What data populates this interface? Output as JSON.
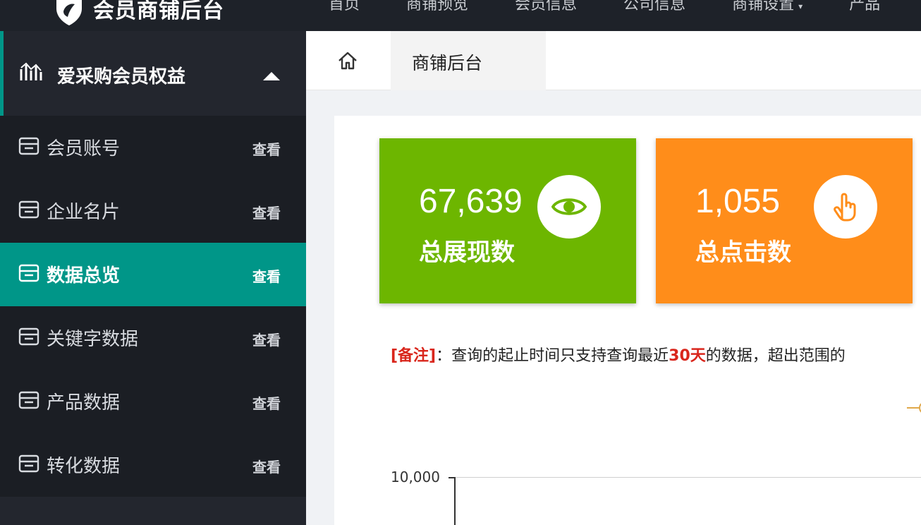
{
  "header": {
    "title": "会员商铺后台",
    "nav": [
      {
        "label": "首页"
      },
      {
        "label": "商铺预览"
      },
      {
        "label": "会员信息"
      },
      {
        "label": "公司信息"
      },
      {
        "label": "商铺设置"
      },
      {
        "label": "产品"
      }
    ]
  },
  "sidebar": {
    "group": {
      "label": "爱采购会员权益",
      "icon": "chart-bars-icon"
    },
    "items": [
      {
        "label": "会员账号",
        "action": "查看"
      },
      {
        "label": "企业名片",
        "action": "查看"
      },
      {
        "label": "数据总览",
        "action": "查看",
        "active": true
      },
      {
        "label": "关键字数据",
        "action": "查看"
      },
      {
        "label": "产品数据",
        "action": "查看"
      },
      {
        "label": "转化数据",
        "action": "查看"
      }
    ]
  },
  "tabs": {
    "home_icon": "home-icon",
    "active_tab": "商铺后台"
  },
  "stats": [
    {
      "value": "67,639",
      "label": "总展现数",
      "icon": "eye-icon",
      "color": "#6db600"
    },
    {
      "value": "1,055",
      "label": "总点击数",
      "icon": "pointer-hand-icon",
      "color": "#ff8d1a"
    }
  ],
  "note": {
    "tag": "[备注]",
    "text_before": "：查询的起止时间只支持查询最近",
    "highlight": "30天",
    "text_after": "的数据，超出范围的"
  },
  "chart": {
    "ytick": "10,000"
  },
  "colors": {
    "accent": "#009688",
    "topbar": "#1e2229",
    "sidebar": "#23262e",
    "note_red": "#d9261c"
  }
}
